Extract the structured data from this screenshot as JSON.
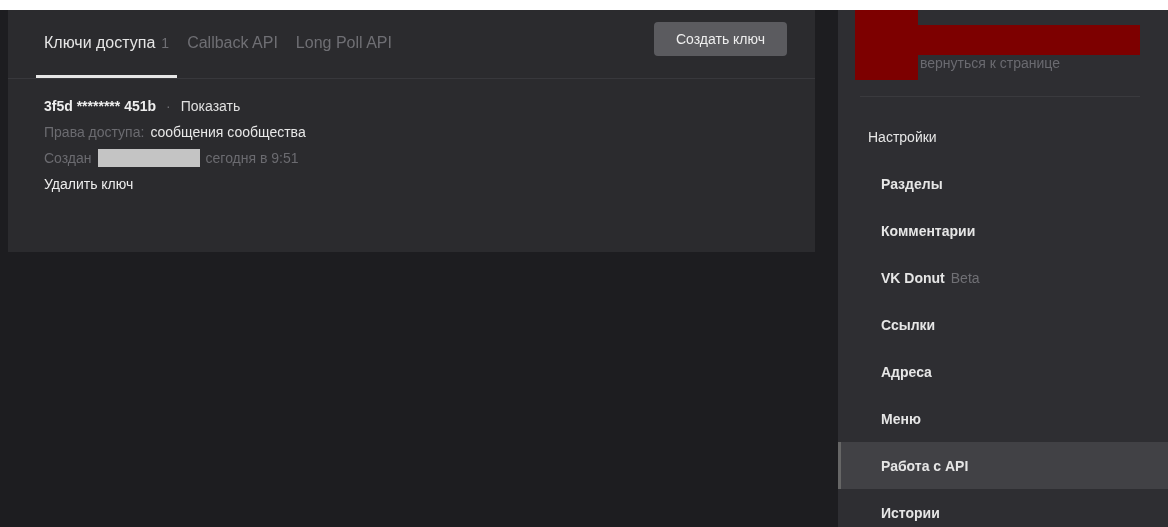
{
  "tabs": [
    {
      "label": "Ключи доступа",
      "count": "1",
      "selected": true
    },
    {
      "label": "Callback API",
      "selected": false
    },
    {
      "label": "Long Poll API",
      "selected": false
    }
  ],
  "create_button": "Создать ключ",
  "key": {
    "value": "3f5d ******** 451b",
    "separator": "·",
    "show_link": "Показать",
    "rights_label": "Права доступа:",
    "rights_value": "сообщения сообщества",
    "created_label": "Создан",
    "created_time": "сегодня в 9:51",
    "delete_link": "Удалить ключ"
  },
  "sidebar": {
    "back_link": "вернуться к странице",
    "items": [
      {
        "kind": "heading",
        "label": "Настройки",
        "selected": false
      },
      {
        "kind": "item",
        "label": "Разделы",
        "selected": false
      },
      {
        "kind": "item",
        "label": "Комментарии",
        "selected": false
      },
      {
        "kind": "item",
        "label": "VK Donut",
        "badge": "Beta",
        "selected": false
      },
      {
        "kind": "item",
        "label": "Ссылки",
        "selected": false
      },
      {
        "kind": "item",
        "label": "Адреса",
        "selected": false
      },
      {
        "kind": "item",
        "label": "Меню",
        "selected": false
      },
      {
        "kind": "item",
        "label": "Работа с API",
        "selected": true
      },
      {
        "kind": "item",
        "label": "Истории",
        "selected": false
      }
    ]
  }
}
